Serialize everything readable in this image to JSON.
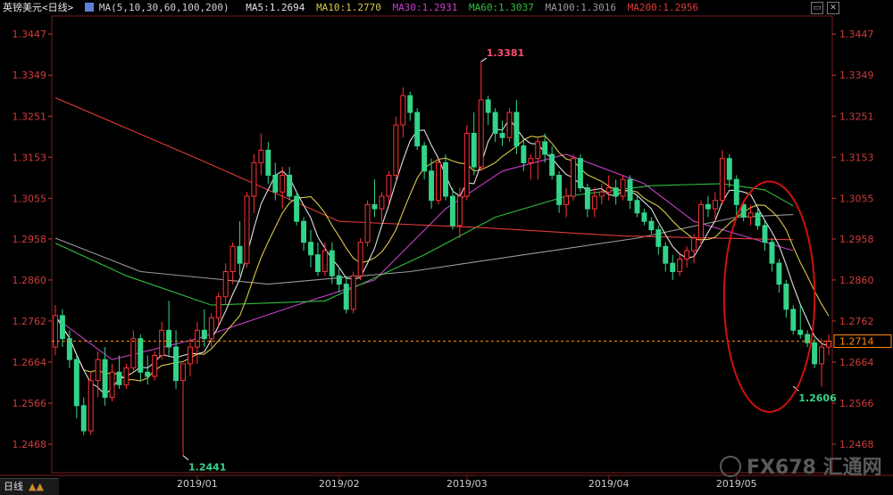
{
  "header": {
    "symbol": "英镑美元<日线>",
    "ma_label": "MA(5,10,30,60,100,200)",
    "ma5": "MA5:1.2694",
    "ma10": "MA10:1.2770",
    "ma30": "MA30:1.2931",
    "ma60": "MA60:1.3037",
    "ma100": "MA100:1.3016",
    "ma200": "MA200:1.2956"
  },
  "toolbar": {
    "btn1": "▭",
    "btn2": "✕"
  },
  "bottom_tab": "日线",
  "watermark": "FX678 汇通网",
  "colors": {
    "up": "#ff3333",
    "down": "#33d48a",
    "ma5": "#e0e0e0",
    "ma10": "#d8c84a",
    "ma30": "#c63fc6",
    "ma60": "#2fbf3f",
    "ma100": "#9a9a9a",
    "ma200": "#e23a3a",
    "axis": "#d33a3a",
    "grid": "#7a1f1f",
    "current": "#ff8a00",
    "circle": "#d01010"
  },
  "chart_data": {
    "type": "candlestick",
    "ylim": [
      1.24,
      1.349
    ],
    "y_ticks": [
      "1.3447",
      "1.3349",
      "1.3251",
      "1.3153",
      "1.3055",
      "1.2958",
      "1.2860",
      "1.2762",
      "1.2664",
      "1.2566",
      "1.2468"
    ],
    "x_labels": [
      "2019/01",
      "2019/02",
      "2019/03",
      "2019/04",
      "2019/05"
    ],
    "x_label_index": [
      20,
      40,
      58,
      78,
      96
    ],
    "candles": [
      {
        "o": 1.27,
        "h": 1.28,
        "l": 1.268,
        "c": 1.2775
      },
      {
        "o": 1.2775,
        "h": 1.279,
        "l": 1.27,
        "c": 1.272
      },
      {
        "o": 1.272,
        "h": 1.274,
        "l": 1.265,
        "c": 1.267
      },
      {
        "o": 1.267,
        "h": 1.268,
        "l": 1.253,
        "c": 1.256
      },
      {
        "o": 1.256,
        "h": 1.258,
        "l": 1.249,
        "c": 1.25
      },
      {
        "o": 1.25,
        "h": 1.264,
        "l": 1.249,
        "c": 1.262
      },
      {
        "o": 1.262,
        "h": 1.269,
        "l": 1.258,
        "c": 1.267
      },
      {
        "o": 1.267,
        "h": 1.27,
        "l": 1.256,
        "c": 1.258
      },
      {
        "o": 1.258,
        "h": 1.266,
        "l": 1.257,
        "c": 1.264
      },
      {
        "o": 1.264,
        "h": 1.268,
        "l": 1.26,
        "c": 1.261
      },
      {
        "o": 1.261,
        "h": 1.266,
        "l": 1.26,
        "c": 1.265
      },
      {
        "o": 1.265,
        "h": 1.274,
        "l": 1.264,
        "c": 1.272
      },
      {
        "o": 1.272,
        "h": 1.273,
        "l": 1.262,
        "c": 1.264
      },
      {
        "o": 1.264,
        "h": 1.268,
        "l": 1.261,
        "c": 1.263
      },
      {
        "o": 1.263,
        "h": 1.269,
        "l": 1.262,
        "c": 1.268
      },
      {
        "o": 1.268,
        "h": 1.276,
        "l": 1.267,
        "c": 1.274
      },
      {
        "o": 1.274,
        "h": 1.281,
        "l": 1.268,
        "c": 1.27
      },
      {
        "o": 1.27,
        "h": 1.274,
        "l": 1.26,
        "c": 1.262
      },
      {
        "o": 1.262,
        "h": 1.264,
        "l": 1.2441,
        "c": 1.266
      },
      {
        "o": 1.266,
        "h": 1.272,
        "l": 1.263,
        "c": 1.27
      },
      {
        "o": 1.27,
        "h": 1.276,
        "l": 1.266,
        "c": 1.274
      },
      {
        "o": 1.274,
        "h": 1.279,
        "l": 1.27,
        "c": 1.272
      },
      {
        "o": 1.272,
        "h": 1.278,
        "l": 1.27,
        "c": 1.277
      },
      {
        "o": 1.277,
        "h": 1.283,
        "l": 1.275,
        "c": 1.282
      },
      {
        "o": 1.282,
        "h": 1.29,
        "l": 1.28,
        "c": 1.288
      },
      {
        "o": 1.288,
        "h": 1.295,
        "l": 1.285,
        "c": 1.294
      },
      {
        "o": 1.294,
        "h": 1.3,
        "l": 1.287,
        "c": 1.29
      },
      {
        "o": 1.29,
        "h": 1.307,
        "l": 1.289,
        "c": 1.306
      },
      {
        "o": 1.306,
        "h": 1.316,
        "l": 1.302,
        "c": 1.314
      },
      {
        "o": 1.314,
        "h": 1.321,
        "l": 1.311,
        "c": 1.317
      },
      {
        "o": 1.317,
        "h": 1.319,
        "l": 1.309,
        "c": 1.311
      },
      {
        "o": 1.311,
        "h": 1.314,
        "l": 1.305,
        "c": 1.307
      },
      {
        "o": 1.307,
        "h": 1.313,
        "l": 1.303,
        "c": 1.311
      },
      {
        "o": 1.311,
        "h": 1.313,
        "l": 1.305,
        "c": 1.306
      },
      {
        "o": 1.306,
        "h": 1.307,
        "l": 1.299,
        "c": 1.3
      },
      {
        "o": 1.3,
        "h": 1.301,
        "l": 1.293,
        "c": 1.295
      },
      {
        "o": 1.295,
        "h": 1.298,
        "l": 1.289,
        "c": 1.292
      },
      {
        "o": 1.292,
        "h": 1.295,
        "l": 1.287,
        "c": 1.288
      },
      {
        "o": 1.288,
        "h": 1.295,
        "l": 1.287,
        "c": 1.293
      },
      {
        "o": 1.293,
        "h": 1.295,
        "l": 1.285,
        "c": 1.287
      },
      {
        "o": 1.287,
        "h": 1.289,
        "l": 1.283,
        "c": 1.285
      },
      {
        "o": 1.285,
        "h": 1.287,
        "l": 1.278,
        "c": 1.279
      },
      {
        "o": 1.279,
        "h": 1.288,
        "l": 1.278,
        "c": 1.287
      },
      {
        "o": 1.287,
        "h": 1.296,
        "l": 1.286,
        "c": 1.295
      },
      {
        "o": 1.295,
        "h": 1.305,
        "l": 1.294,
        "c": 1.304
      },
      {
        "o": 1.304,
        "h": 1.31,
        "l": 1.301,
        "c": 1.303
      },
      {
        "o": 1.303,
        "h": 1.307,
        "l": 1.3,
        "c": 1.306
      },
      {
        "o": 1.306,
        "h": 1.312,
        "l": 1.304,
        "c": 1.311
      },
      {
        "o": 1.311,
        "h": 1.325,
        "l": 1.31,
        "c": 1.323
      },
      {
        "o": 1.323,
        "h": 1.332,
        "l": 1.32,
        "c": 1.33
      },
      {
        "o": 1.33,
        "h": 1.331,
        "l": 1.324,
        "c": 1.326
      },
      {
        "o": 1.326,
        "h": 1.327,
        "l": 1.317,
        "c": 1.318
      },
      {
        "o": 1.318,
        "h": 1.319,
        "l": 1.31,
        "c": 1.312
      },
      {
        "o": 1.312,
        "h": 1.315,
        "l": 1.303,
        "c": 1.305
      },
      {
        "o": 1.305,
        "h": 1.315,
        "l": 1.304,
        "c": 1.314
      },
      {
        "o": 1.314,
        "h": 1.316,
        "l": 1.305,
        "c": 1.306
      },
      {
        "o": 1.306,
        "h": 1.308,
        "l": 1.298,
        "c": 1.299
      },
      {
        "o": 1.299,
        "h": 1.308,
        "l": 1.296,
        "c": 1.306
      },
      {
        "o": 1.306,
        "h": 1.323,
        "l": 1.305,
        "c": 1.321
      },
      {
        "o": 1.321,
        "h": 1.326,
        "l": 1.311,
        "c": 1.313
      },
      {
        "o": 1.313,
        "h": 1.3381,
        "l": 1.312,
        "c": 1.329
      },
      {
        "o": 1.329,
        "h": 1.33,
        "l": 1.323,
        "c": 1.326
      },
      {
        "o": 1.326,
        "h": 1.327,
        "l": 1.319,
        "c": 1.321
      },
      {
        "o": 1.321,
        "h": 1.324,
        "l": 1.318,
        "c": 1.32
      },
      {
        "o": 1.32,
        "h": 1.327,
        "l": 1.319,
        "c": 1.326
      },
      {
        "o": 1.326,
        "h": 1.329,
        "l": 1.316,
        "c": 1.318
      },
      {
        "o": 1.318,
        "h": 1.32,
        "l": 1.312,
        "c": 1.314
      },
      {
        "o": 1.314,
        "h": 1.316,
        "l": 1.31,
        "c": 1.315
      },
      {
        "o": 1.315,
        "h": 1.32,
        "l": 1.31,
        "c": 1.319
      },
      {
        "o": 1.319,
        "h": 1.321,
        "l": 1.314,
        "c": 1.316
      },
      {
        "o": 1.316,
        "h": 1.318,
        "l": 1.31,
        "c": 1.311
      },
      {
        "o": 1.311,
        "h": 1.312,
        "l": 1.302,
        "c": 1.304
      },
      {
        "o": 1.304,
        "h": 1.308,
        "l": 1.301,
        "c": 1.306
      },
      {
        "o": 1.306,
        "h": 1.316,
        "l": 1.305,
        "c": 1.315
      },
      {
        "o": 1.315,
        "h": 1.316,
        "l": 1.307,
        "c": 1.308
      },
      {
        "o": 1.308,
        "h": 1.309,
        "l": 1.301,
        "c": 1.303
      },
      {
        "o": 1.303,
        "h": 1.308,
        "l": 1.301,
        "c": 1.306
      },
      {
        "o": 1.306,
        "h": 1.309,
        "l": 1.304,
        "c": 1.307
      },
      {
        "o": 1.307,
        "h": 1.311,
        "l": 1.305,
        "c": 1.308
      },
      {
        "o": 1.308,
        "h": 1.31,
        "l": 1.304,
        "c": 1.306
      },
      {
        "o": 1.306,
        "h": 1.311,
        "l": 1.305,
        "c": 1.31
      },
      {
        "o": 1.31,
        "h": 1.311,
        "l": 1.303,
        "c": 1.305
      },
      {
        "o": 1.305,
        "h": 1.306,
        "l": 1.301,
        "c": 1.302
      },
      {
        "o": 1.302,
        "h": 1.303,
        "l": 1.299,
        "c": 1.3
      },
      {
        "o": 1.3,
        "h": 1.301,
        "l": 1.297,
        "c": 1.298
      },
      {
        "o": 1.298,
        "h": 1.299,
        "l": 1.292,
        "c": 1.294
      },
      {
        "o": 1.294,
        "h": 1.295,
        "l": 1.288,
        "c": 1.29
      },
      {
        "o": 1.29,
        "h": 1.292,
        "l": 1.286,
        "c": 1.288
      },
      {
        "o": 1.288,
        "h": 1.292,
        "l": 1.287,
        "c": 1.291
      },
      {
        "o": 1.291,
        "h": 1.294,
        "l": 1.289,
        "c": 1.293
      },
      {
        "o": 1.293,
        "h": 1.297,
        "l": 1.29,
        "c": 1.296
      },
      {
        "o": 1.296,
        "h": 1.305,
        "l": 1.294,
        "c": 1.304
      },
      {
        "o": 1.304,
        "h": 1.306,
        "l": 1.301,
        "c": 1.303
      },
      {
        "o": 1.303,
        "h": 1.307,
        "l": 1.3,
        "c": 1.305
      },
      {
        "o": 1.305,
        "h": 1.317,
        "l": 1.304,
        "c": 1.315
      },
      {
        "o": 1.315,
        "h": 1.316,
        "l": 1.308,
        "c": 1.31
      },
      {
        "o": 1.31,
        "h": 1.311,
        "l": 1.301,
        "c": 1.304
      },
      {
        "o": 1.304,
        "h": 1.305,
        "l": 1.3,
        "c": 1.301
      },
      {
        "o": 1.301,
        "h": 1.304,
        "l": 1.299,
        "c": 1.302
      },
      {
        "o": 1.302,
        "h": 1.303,
        "l": 1.298,
        "c": 1.299
      },
      {
        "o": 1.299,
        "h": 1.3,
        "l": 1.293,
        "c": 1.295
      },
      {
        "o": 1.295,
        "h": 1.296,
        "l": 1.288,
        "c": 1.29
      },
      {
        "o": 1.29,
        "h": 1.291,
        "l": 1.283,
        "c": 1.285
      },
      {
        "o": 1.285,
        "h": 1.286,
        "l": 1.277,
        "c": 1.279
      },
      {
        "o": 1.279,
        "h": 1.28,
        "l": 1.273,
        "c": 1.274
      },
      {
        "o": 1.274,
        "h": 1.28,
        "l": 1.272,
        "c": 1.273
      },
      {
        "o": 1.273,
        "h": 1.274,
        "l": 1.27,
        "c": 1.271
      },
      {
        "o": 1.271,
        "h": 1.272,
        "l": 1.265,
        "c": 1.266
      },
      {
        "o": 1.266,
        "h": 1.272,
        "l": 1.2606,
        "c": 1.27
      },
      {
        "o": 1.27,
        "h": 1.273,
        "l": 1.268,
        "c": 1.2714
      }
    ],
    "ma_lines": {
      "ma30": {
        "x": [
          0,
          8,
          20,
          34,
          45,
          55,
          63,
          72,
          83,
          90,
          104
        ],
        "y": [
          1.277,
          1.267,
          1.272,
          1.28,
          1.286,
          1.303,
          1.312,
          1.316,
          1.309,
          1.3,
          1.293
        ]
      },
      "ma60": {
        "x": [
          0,
          10,
          22,
          38,
          52,
          62,
          72,
          84,
          94,
          100,
          104
        ],
        "y": [
          1.2948,
          1.287,
          1.28,
          1.281,
          1.292,
          1.301,
          1.306,
          1.3085,
          1.309,
          1.3075,
          1.3037
        ]
      },
      "ma100": {
        "x": [
          0,
          12,
          30,
          50,
          66,
          82,
          96,
          104
        ],
        "y": [
          1.296,
          1.288,
          1.285,
          1.288,
          1.292,
          1.296,
          1.301,
          1.3016
        ]
      },
      "ma200": {
        "x": [
          0,
          20,
          40,
          60,
          80,
          104
        ],
        "y": [
          1.3295,
          1.315,
          1.3,
          1.2985,
          1.2965,
          1.2956
        ]
      }
    },
    "current_price": "1.2714",
    "annotations": [
      {
        "text": "1.3381",
        "i": 60,
        "price": 1.3381,
        "pos": "above"
      },
      {
        "text": "1.2441",
        "i": 18,
        "price": 1.2441,
        "pos": "below"
      },
      {
        "text": "1.2606",
        "i": 104,
        "price": 1.2606,
        "pos": "below"
      }
    ]
  }
}
